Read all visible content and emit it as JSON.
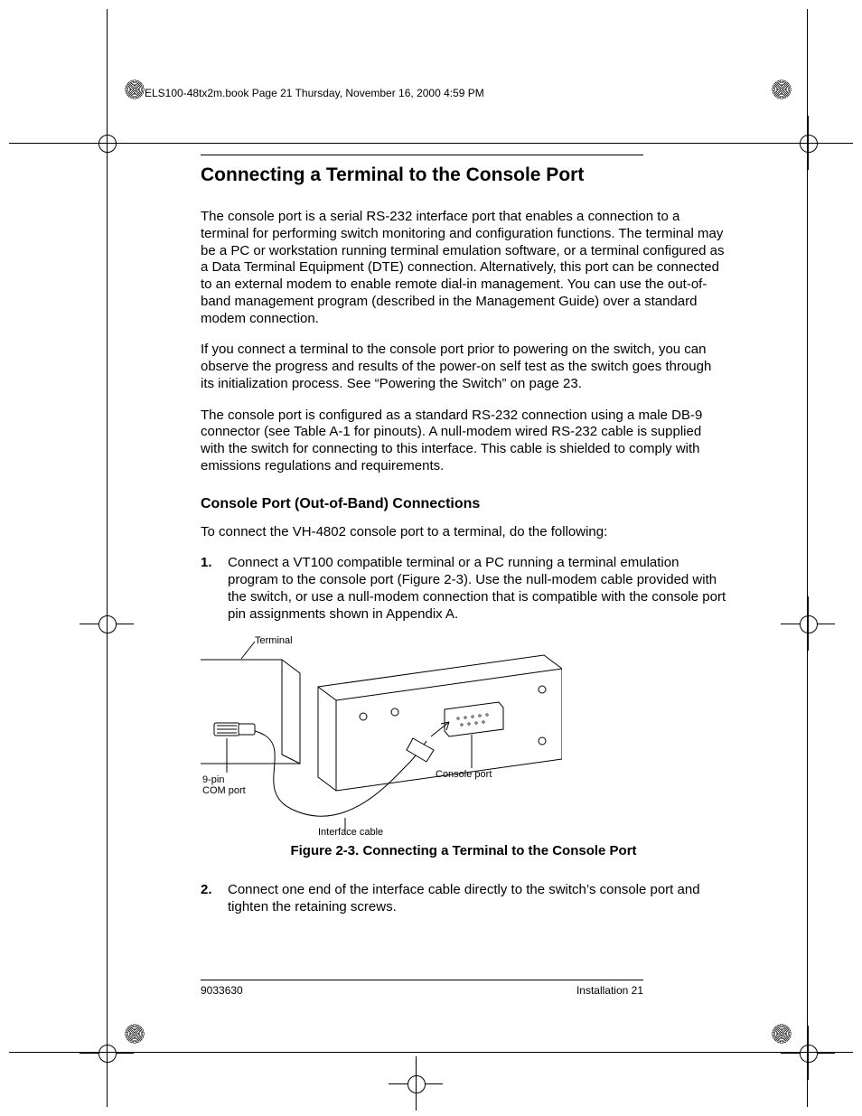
{
  "header": {
    "runhead": "ELS100-48tx2m.book  Page 21  Thursday, November 16, 2000  4:59 PM"
  },
  "headings": {
    "h1": "Connecting a Terminal to the Console Port",
    "h2": "Console Port (Out-of-Band) Connections"
  },
  "paragraphs": {
    "p1": "The console port is a serial RS-232 interface port that enables a connection to a terminal for performing switch monitoring and configuration functions. The terminal may be a PC or workstation running terminal emulation software, or a terminal configured as a Data Terminal Equipment (DTE) connection. Alternatively, this port can be connected to an external modem to enable remote dial-in management. You can use the out-of-band management program (described in the Management Guide) over a standard modem connection.",
    "p2": "If you connect a terminal to the console port prior to powering on the switch, you can observe the progress and results of the power-on self test as the switch goes through its initialization process. See “Powering the Switch” on page 23.",
    "p3": "The console port is configured as a standard RS-232 connection using a male DB-9 connector (see Table A-1 for pinouts). A null-modem wired RS-232 cable is supplied with the switch for connecting to this interface. This cable is shielded to comply with emissions regulations and requirements.",
    "p4": "To connect the VH-4802 console port to a terminal, do the following:"
  },
  "steps": {
    "s1_num": "1.",
    "s1": "Connect a VT100 compatible terminal or a PC running a terminal emulation program to the console port (Figure 2-3). Use the null-modem cable provided with the switch, or use a null-modem connection that is compatible with the console port pin assignments shown in Appendix A.",
    "s2_num": "2.",
    "s2": "Connect one end of the interface cable directly to the switch’s console port and tighten the retaining screws."
  },
  "figure": {
    "caption": "Figure 2-3.  Connecting a Terminal to the Console Port",
    "labels": {
      "terminal": "Terminal",
      "com_port_a": "9-pin",
      "com_port_b": "COM port",
      "console_port": "Console port",
      "interface_cable": "Interface cable"
    }
  },
  "footer": {
    "left": "9033630",
    "right": "Installation  21"
  }
}
